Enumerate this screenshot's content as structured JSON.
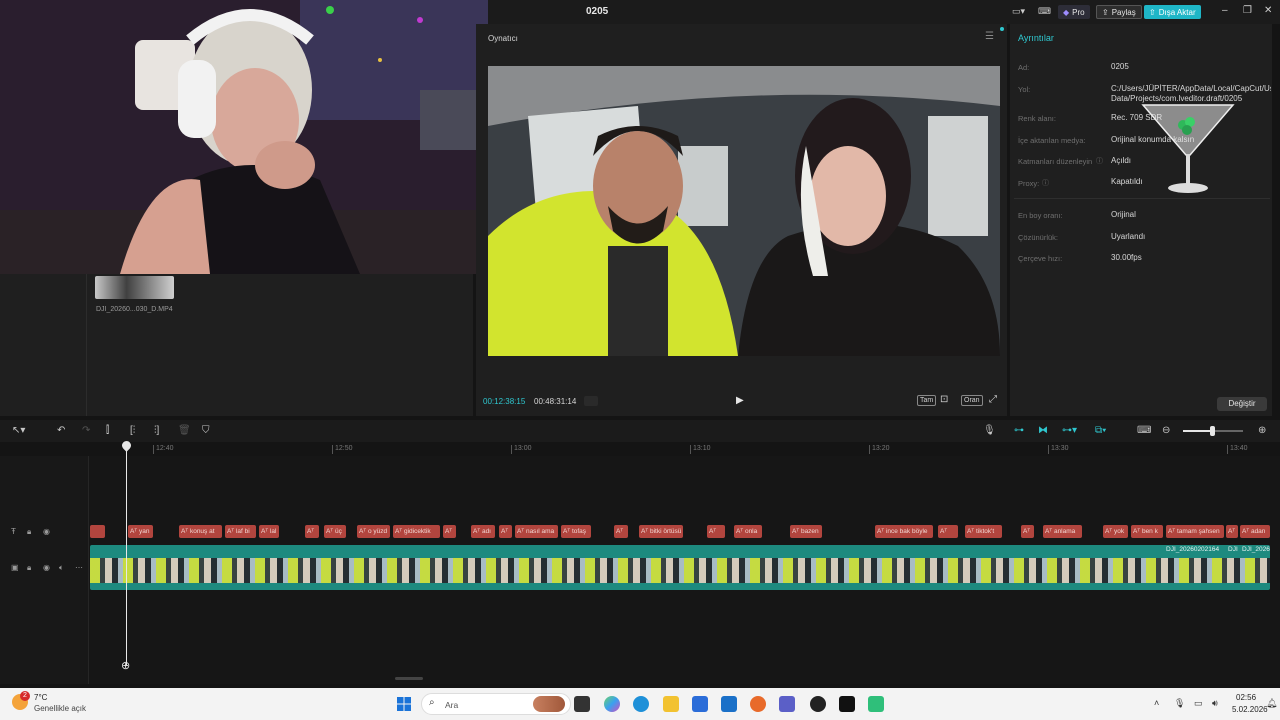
{
  "window": {
    "title": "0205"
  },
  "header": {
    "pro_label": "Pro",
    "share_label": "Paylaş",
    "export_label": "Dışa Aktar"
  },
  "media": {
    "thumb_name": "DJI_20260...030_D.MP4"
  },
  "player": {
    "label": "Oynatıcı",
    "current_time": "00:12:38:15",
    "total_time": "00:48:31:14",
    "controls": [
      "Tam",
      "Oran"
    ]
  },
  "details": {
    "title": "Ayrıntılar",
    "fields": [
      {
        "label": "Ad:",
        "value": "0205"
      },
      {
        "label": "Yol:",
        "value": "C:/Users/JÜPİTER/AppData/Local/CapCut/User Data/Projects/com.lveditor.draft/0205"
      },
      {
        "label": "Renk alanı:",
        "value": "Rec. 709 SDR"
      },
      {
        "label": "İçe aktarılan medya:",
        "value": "Orijinal konumda kalsın"
      },
      {
        "label": "Katmanları düzenleyin",
        "value": "Açıldı"
      },
      {
        "label": "Proxy:",
        "value": "Kapatıldı"
      },
      {
        "label": "En boy oranı:",
        "value": "Orijinal"
      },
      {
        "label": "Çözünürlük:",
        "value": "Uyarlandı"
      },
      {
        "label": "Çerçeve hızı:",
        "value": "30.00fps"
      }
    ],
    "change_label": "Değiştir"
  },
  "timeline": {
    "ruler": [
      "12:40",
      "12:50",
      "13:00",
      "13:10",
      "13:20",
      "13:30",
      "13:40"
    ],
    "captions": [
      "yan",
      "konuş at",
      "laf bi",
      "lal",
      "Aᵀ",
      "üç",
      "o yüzd",
      "gidicektik",
      "Aᵀ",
      "adı",
      "Aᵀ",
      "nasıl ama",
      "tofaş",
      "Aᵀ",
      "bitki örtüsü",
      "Aᵀ",
      "onla",
      "bazen",
      "ince bak böyle",
      "Aᵀ",
      "tiktok't",
      "Aᵀ",
      "anlama",
      "yok",
      "ben k",
      "tamam şahsen",
      "Aᵀ",
      "adan"
    ],
    "clip_labels": [
      "DJI_20260202164",
      "DJI",
      "DJI_2026"
    ],
    "zoom_fraction": 0.5
  },
  "taskbar": {
    "weather_temp": "7°C",
    "weather_desc": "Genellikle açık",
    "weather_badge": "2",
    "search_placeholder": "Ara",
    "time": "02:56",
    "date": "5.02.2026"
  },
  "colors": {
    "accent": "#2fc7cf",
    "caption": "#b2453e",
    "video_track": "#1d8a7f"
  }
}
